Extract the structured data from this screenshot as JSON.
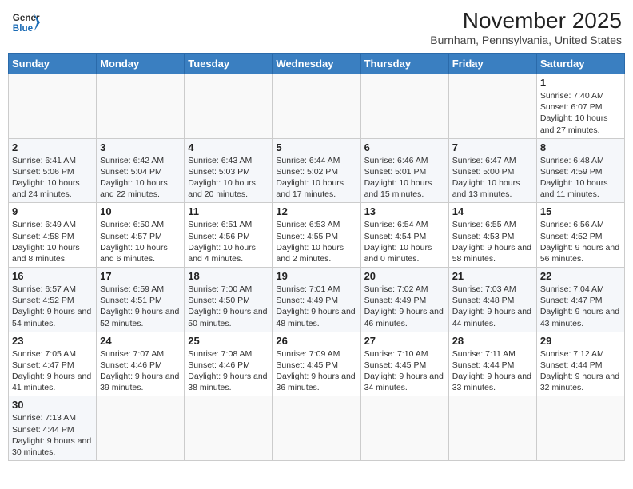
{
  "header": {
    "logo_line1": "General",
    "logo_line2": "Blue",
    "title": "November 2025",
    "subtitle": "Burnham, Pennsylvania, United States"
  },
  "days_of_week": [
    "Sunday",
    "Monday",
    "Tuesday",
    "Wednesday",
    "Thursday",
    "Friday",
    "Saturday"
  ],
  "weeks": [
    [
      {
        "day": "",
        "info": ""
      },
      {
        "day": "",
        "info": ""
      },
      {
        "day": "",
        "info": ""
      },
      {
        "day": "",
        "info": ""
      },
      {
        "day": "",
        "info": ""
      },
      {
        "day": "",
        "info": ""
      },
      {
        "day": "1",
        "info": "Sunrise: 7:40 AM\nSunset: 6:07 PM\nDaylight: 10 hours and 27 minutes."
      }
    ],
    [
      {
        "day": "2",
        "info": "Sunrise: 6:41 AM\nSunset: 5:06 PM\nDaylight: 10 hours and 24 minutes."
      },
      {
        "day": "3",
        "info": "Sunrise: 6:42 AM\nSunset: 5:04 PM\nDaylight: 10 hours and 22 minutes."
      },
      {
        "day": "4",
        "info": "Sunrise: 6:43 AM\nSunset: 5:03 PM\nDaylight: 10 hours and 20 minutes."
      },
      {
        "day": "5",
        "info": "Sunrise: 6:44 AM\nSunset: 5:02 PM\nDaylight: 10 hours and 17 minutes."
      },
      {
        "day": "6",
        "info": "Sunrise: 6:46 AM\nSunset: 5:01 PM\nDaylight: 10 hours and 15 minutes."
      },
      {
        "day": "7",
        "info": "Sunrise: 6:47 AM\nSunset: 5:00 PM\nDaylight: 10 hours and 13 minutes."
      },
      {
        "day": "8",
        "info": "Sunrise: 6:48 AM\nSunset: 4:59 PM\nDaylight: 10 hours and 11 minutes."
      }
    ],
    [
      {
        "day": "9",
        "info": "Sunrise: 6:49 AM\nSunset: 4:58 PM\nDaylight: 10 hours and 8 minutes."
      },
      {
        "day": "10",
        "info": "Sunrise: 6:50 AM\nSunset: 4:57 PM\nDaylight: 10 hours and 6 minutes."
      },
      {
        "day": "11",
        "info": "Sunrise: 6:51 AM\nSunset: 4:56 PM\nDaylight: 10 hours and 4 minutes."
      },
      {
        "day": "12",
        "info": "Sunrise: 6:53 AM\nSunset: 4:55 PM\nDaylight: 10 hours and 2 minutes."
      },
      {
        "day": "13",
        "info": "Sunrise: 6:54 AM\nSunset: 4:54 PM\nDaylight: 10 hours and 0 minutes."
      },
      {
        "day": "14",
        "info": "Sunrise: 6:55 AM\nSunset: 4:53 PM\nDaylight: 9 hours and 58 minutes."
      },
      {
        "day": "15",
        "info": "Sunrise: 6:56 AM\nSunset: 4:52 PM\nDaylight: 9 hours and 56 minutes."
      }
    ],
    [
      {
        "day": "16",
        "info": "Sunrise: 6:57 AM\nSunset: 4:52 PM\nDaylight: 9 hours and 54 minutes."
      },
      {
        "day": "17",
        "info": "Sunrise: 6:59 AM\nSunset: 4:51 PM\nDaylight: 9 hours and 52 minutes."
      },
      {
        "day": "18",
        "info": "Sunrise: 7:00 AM\nSunset: 4:50 PM\nDaylight: 9 hours and 50 minutes."
      },
      {
        "day": "19",
        "info": "Sunrise: 7:01 AM\nSunset: 4:49 PM\nDaylight: 9 hours and 48 minutes."
      },
      {
        "day": "20",
        "info": "Sunrise: 7:02 AM\nSunset: 4:49 PM\nDaylight: 9 hours and 46 minutes."
      },
      {
        "day": "21",
        "info": "Sunrise: 7:03 AM\nSunset: 4:48 PM\nDaylight: 9 hours and 44 minutes."
      },
      {
        "day": "22",
        "info": "Sunrise: 7:04 AM\nSunset: 4:47 PM\nDaylight: 9 hours and 43 minutes."
      }
    ],
    [
      {
        "day": "23",
        "info": "Sunrise: 7:05 AM\nSunset: 4:47 PM\nDaylight: 9 hours and 41 minutes."
      },
      {
        "day": "24",
        "info": "Sunrise: 7:07 AM\nSunset: 4:46 PM\nDaylight: 9 hours and 39 minutes."
      },
      {
        "day": "25",
        "info": "Sunrise: 7:08 AM\nSunset: 4:46 PM\nDaylight: 9 hours and 38 minutes."
      },
      {
        "day": "26",
        "info": "Sunrise: 7:09 AM\nSunset: 4:45 PM\nDaylight: 9 hours and 36 minutes."
      },
      {
        "day": "27",
        "info": "Sunrise: 7:10 AM\nSunset: 4:45 PM\nDaylight: 9 hours and 34 minutes."
      },
      {
        "day": "28",
        "info": "Sunrise: 7:11 AM\nSunset: 4:44 PM\nDaylight: 9 hours and 33 minutes."
      },
      {
        "day": "29",
        "info": "Sunrise: 7:12 AM\nSunset: 4:44 PM\nDaylight: 9 hours and 32 minutes."
      }
    ],
    [
      {
        "day": "30",
        "info": "Sunrise: 7:13 AM\nSunset: 4:44 PM\nDaylight: 9 hours and 30 minutes."
      },
      {
        "day": "",
        "info": ""
      },
      {
        "day": "",
        "info": ""
      },
      {
        "day": "",
        "info": ""
      },
      {
        "day": "",
        "info": ""
      },
      {
        "day": "",
        "info": ""
      },
      {
        "day": "",
        "info": ""
      }
    ]
  ]
}
